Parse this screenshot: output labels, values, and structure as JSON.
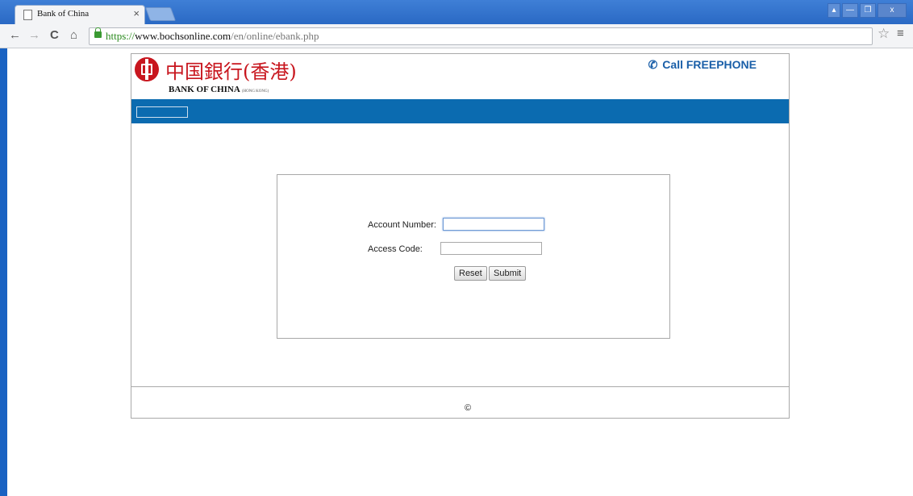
{
  "browser": {
    "tab_title": "Bank of China",
    "tab_close": "×",
    "window_buttons": [
      "▴",
      "—",
      "❐",
      "x"
    ],
    "url_protocol": "https://",
    "url_host": "www.bochsonline.com",
    "url_path": "/en/online/ebank.php",
    "nav": {
      "back": "←",
      "forward": "→",
      "reload": "C",
      "home": "⌂"
    },
    "star": "☆",
    "menu": "≡"
  },
  "header": {
    "logo_cn": "中国銀行(香港)",
    "logo_en": "BANK OF CHINA",
    "logo_en_sub": "(HONG KONG)",
    "freephone_label": "Call FREEPHONE",
    "phone_icon": "phone-icon",
    "brand_red": "#c8161e",
    "brand_blue": "#0b6bb0"
  },
  "login": {
    "account_label": "Account Number:",
    "account_value": "",
    "access_label": "Access Code:",
    "access_value": "",
    "reset_label": "Reset",
    "submit_label": "Submit"
  },
  "footer": {
    "copyright": "©"
  }
}
